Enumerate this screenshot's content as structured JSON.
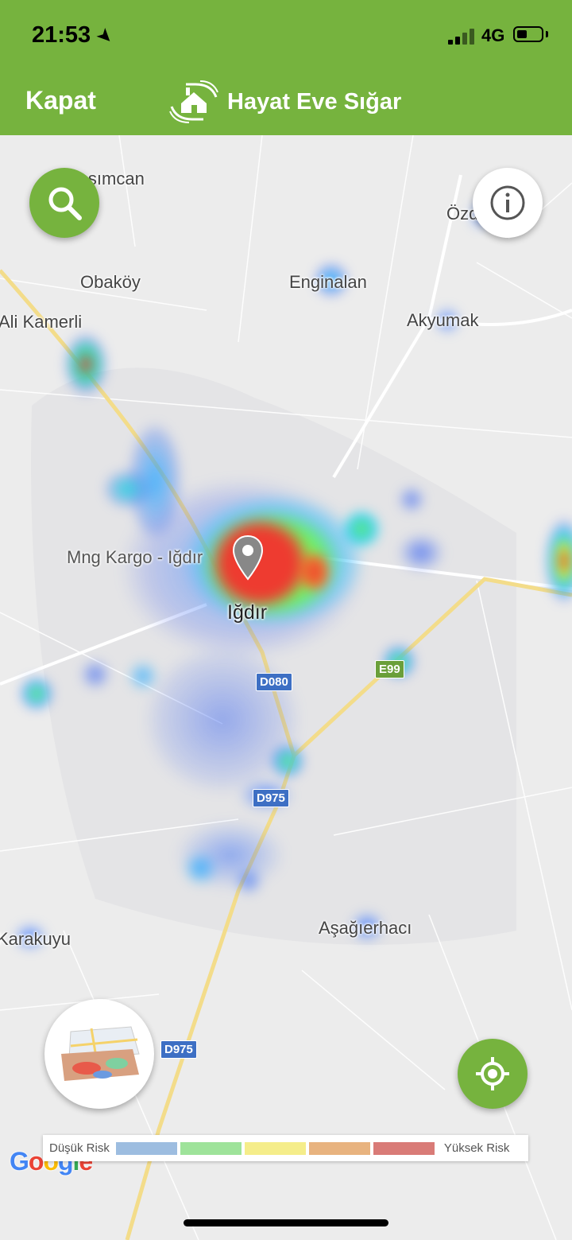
{
  "status_bar": {
    "time": "21:53",
    "network": "4G"
  },
  "header": {
    "close_label": "Kapat",
    "title": "Hayat Eve Sığar",
    "brand_color": "#76b33e"
  },
  "map": {
    "places": [
      {
        "name": "Kasımcan"
      },
      {
        "name": "Özdemir"
      },
      {
        "name": "Obaköy"
      },
      {
        "name": "Enginalan"
      },
      {
        "name": "Akyumak"
      },
      {
        "name": "Ali Kamerli"
      },
      {
        "name": "Mng Kargo - Iğdır"
      },
      {
        "name": "Iğdır"
      },
      {
        "name": "Aşağıerhacı"
      },
      {
        "name": "Karakuyu"
      }
    ],
    "road_labels": [
      "D080",
      "E99",
      "D975",
      "D975"
    ],
    "attribution": "Google"
  },
  "legend": {
    "low_label": "Düşük Risk",
    "high_label": "Yüksek Risk",
    "colors": [
      "#9dbde0",
      "#9ee39a",
      "#f5ed8a",
      "#e8b37f",
      "#d97b77"
    ]
  },
  "icons": {
    "search": "search-icon",
    "info": "info-icon",
    "layers": "map-layers-icon",
    "locate": "crosshair-icon",
    "pin": "location-pin-icon",
    "brand": "home-in-hands-icon"
  }
}
